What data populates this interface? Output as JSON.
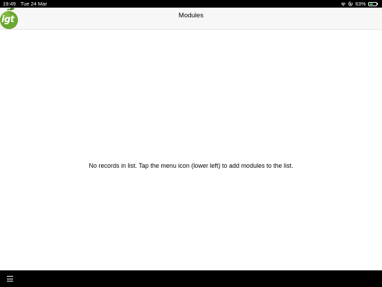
{
  "status_bar": {
    "time": "19:49",
    "date": "Tue 24 Mar",
    "battery_percent": "63%",
    "battery_level": 0.63,
    "icons": [
      "wifi-icon",
      "orientation-lock-icon",
      "battery-icon"
    ]
  },
  "header": {
    "title": "Modules",
    "logo_text": "igt"
  },
  "main": {
    "empty_message": "No records in list. Tap the menu icon (lower left) to add modules to the list."
  },
  "toolbar": {
    "menu_icon": "hamburger-menu-icon"
  },
  "colors": {
    "status_bar_bg": "#000000",
    "header_bg": "#f7f7f7",
    "logo_green": "#6aa72e",
    "battery_green": "#4cd964",
    "toolbar_bg": "#000000"
  }
}
